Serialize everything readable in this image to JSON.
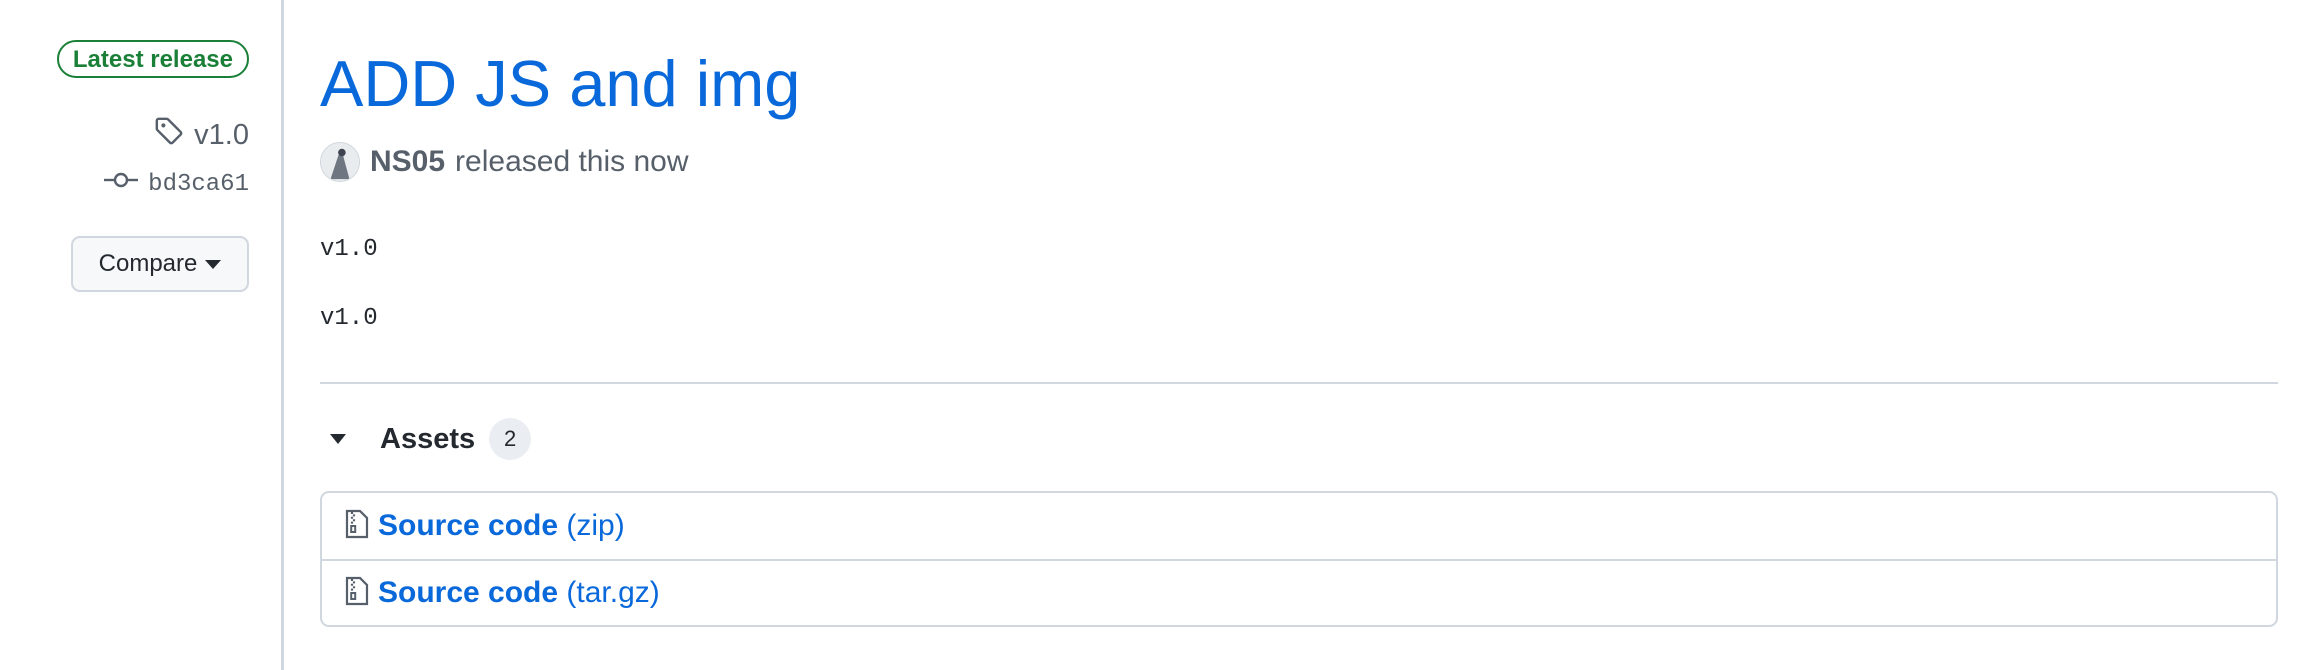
{
  "sidebar": {
    "badge": "Latest release",
    "tag": "v1.0",
    "commit": "bd3ca61",
    "compare_label": "Compare"
  },
  "release": {
    "title": "ADD JS and img",
    "author": "NS05",
    "released_text": "released this now",
    "body_lines": [
      "v1.0",
      "v1.0"
    ]
  },
  "assets": {
    "label": "Assets",
    "count": "2",
    "items": [
      {
        "name": "Source code",
        "ext": "(zip)"
      },
      {
        "name": "Source code",
        "ext": "(tar.gz)"
      }
    ]
  },
  "icons": {
    "tag": "tag-icon",
    "commit": "git-commit-icon",
    "file_zip": "file-zip-icon",
    "caret": "triangle-down-icon"
  },
  "colors": {
    "link": "#0969da",
    "latest_badge": "#1a7f37",
    "border": "#d0d7de"
  }
}
